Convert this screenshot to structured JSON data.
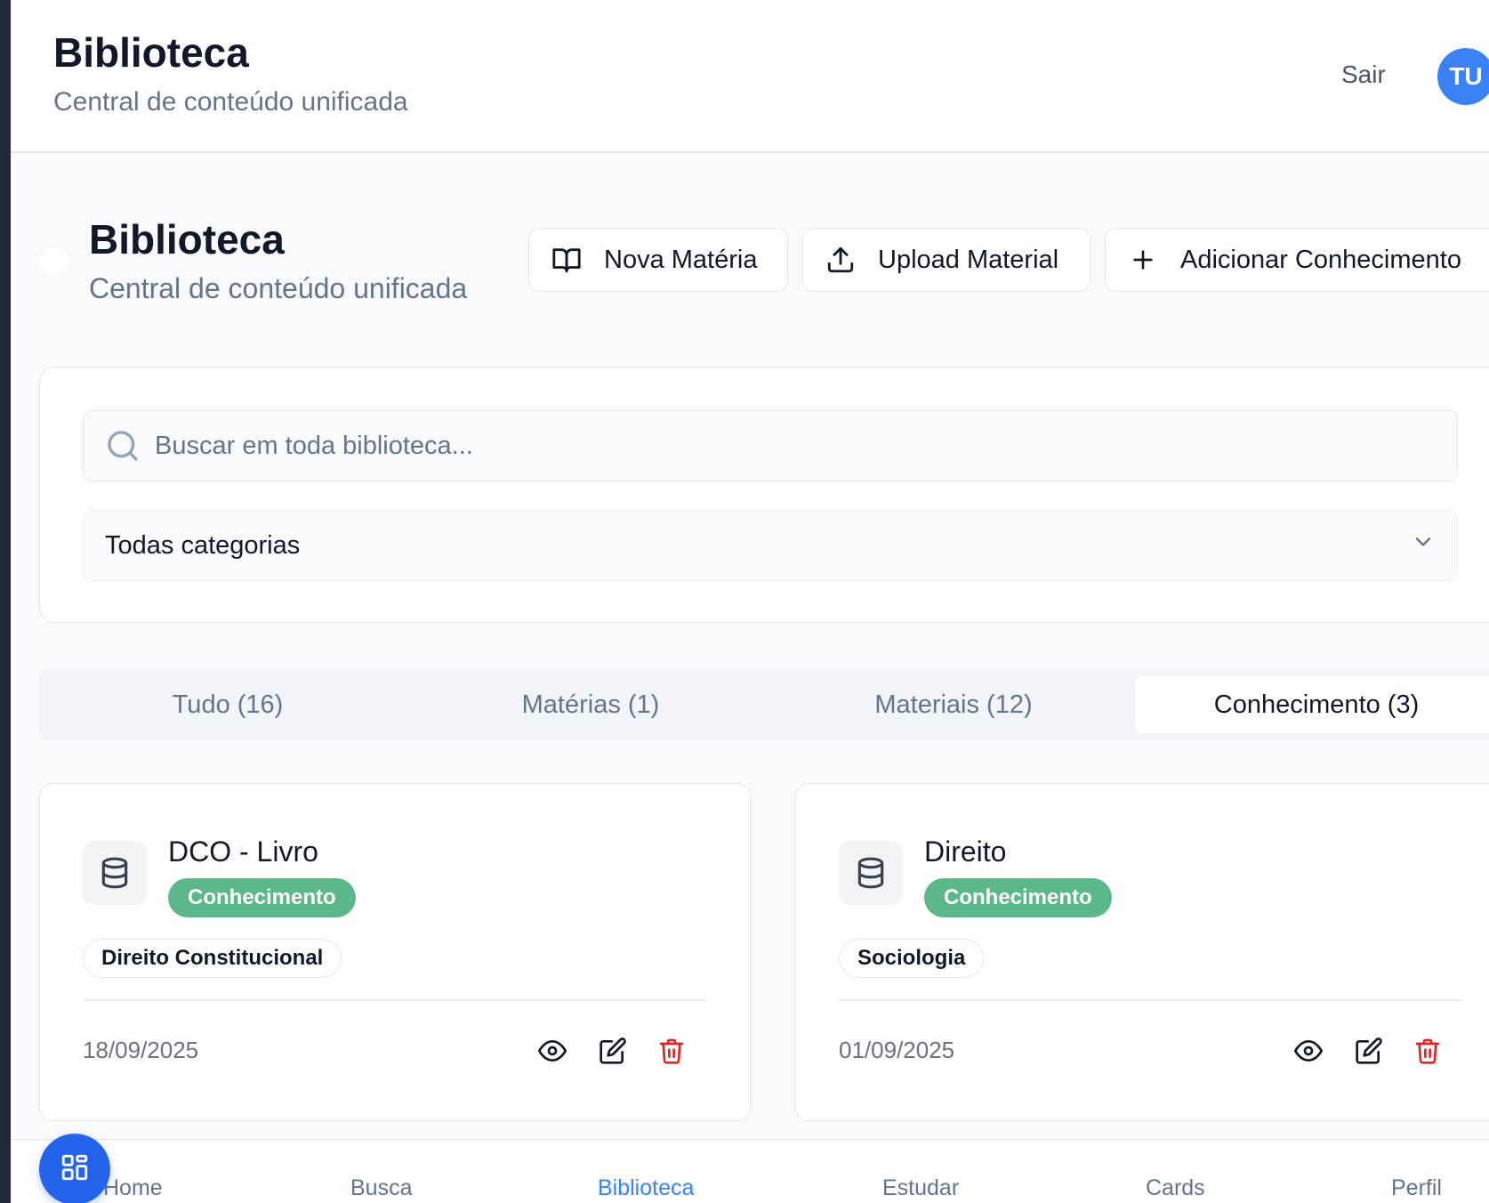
{
  "header": {
    "title": "Biblioteca",
    "subtitle": "Central de conteúdo unificada",
    "logout_label": "Sair",
    "avatar_initials": "TU",
    "avatar_color": "#3b82f6"
  },
  "page_header": {
    "title": "Biblioteca",
    "subtitle": "Central de conteúdo unificada",
    "actions": [
      {
        "label": "Nova Matéria",
        "icon": "book-open-icon"
      },
      {
        "label": "Upload Material",
        "icon": "upload-icon"
      },
      {
        "label": "Adicionar Conhecimento",
        "icon": "plus-icon"
      }
    ]
  },
  "filters": {
    "search_placeholder": "Buscar em toda biblioteca...",
    "category_selected": "Todas categorias"
  },
  "tabs": [
    {
      "label": "Tudo (16)",
      "active": false
    },
    {
      "label": "Matérias (1)",
      "active": false
    },
    {
      "label": "Materiais (12)",
      "active": false
    },
    {
      "label": "Conhecimento (3)",
      "active": true
    }
  ],
  "cards": [
    {
      "title": "DCO - Livro",
      "badge": "Conhecimento",
      "tag": "Direito Constitucional",
      "date": "18/09/2025",
      "icon": "database-icon"
    },
    {
      "title": "Direito",
      "badge": "Conhecimento",
      "tag": "Sociologia",
      "date": "01/09/2025",
      "icon": "database-icon"
    }
  ],
  "colors": {
    "badge": "#5cb88b",
    "accent": "#3b82f6",
    "delete": "#dc2626",
    "fab": "#2563eb"
  },
  "bottom_nav": [
    {
      "label": "Home",
      "active": false
    },
    {
      "label": "Busca",
      "active": false
    },
    {
      "label": "Biblioteca",
      "active": true
    },
    {
      "label": "Estudar",
      "active": false
    },
    {
      "label": "Cards",
      "active": false
    },
    {
      "label": "Perfil",
      "active": false
    }
  ]
}
